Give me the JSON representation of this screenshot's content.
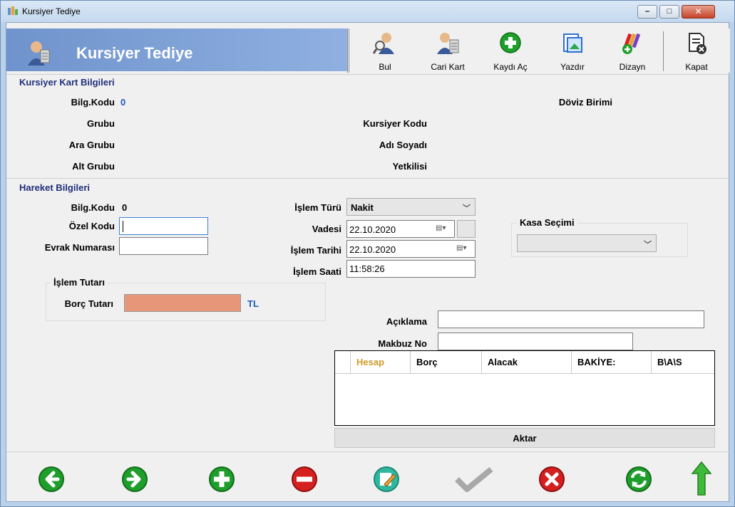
{
  "window": {
    "title": "Kursiyer Tediye",
    "controls": {
      "minimize": "–",
      "maximize": "□",
      "close": "✕"
    }
  },
  "header": {
    "title": "Kursiyer Tediye"
  },
  "toolbar": {
    "buttons": [
      {
        "key": "bul",
        "label": "Bul",
        "icon": "search-user-icon"
      },
      {
        "key": "cari_kart",
        "label": "Cari Kart",
        "icon": "user-card-icon"
      },
      {
        "key": "kaydi_ac",
        "label": "Kaydı Aç",
        "icon": "add-record-icon"
      },
      {
        "key": "yazdir",
        "label": "Yazdır",
        "icon": "print-icon"
      },
      {
        "key": "dizayn",
        "label": "Dizayn",
        "icon": "design-icon"
      },
      {
        "key": "kapat",
        "label": "Kapat",
        "icon": "close-document-icon"
      }
    ]
  },
  "kart": {
    "group_title": "Kursiyer Kart Bilgileri",
    "bilg_kodu_label": "Bilg.Kodu",
    "bilg_kodu_value": "0",
    "doviz_birimi_label": "Döviz Birimi",
    "grubu_label": "Grubu",
    "kursiyer_kodu_label": "Kursiyer Kodu",
    "ara_grubu_label": "Ara Grubu",
    "adi_soyadi_label": "Adı Soyadı",
    "alt_grubu_label": "Alt Grubu",
    "yetkilisi_label": "Yetkilisi"
  },
  "hareket": {
    "group_title": "Hareket Bilgileri",
    "bilg_kodu_label": "Bilg.Kodu",
    "bilg_kodu_value": "0",
    "ozel_kodu_label": "Özel Kodu",
    "ozel_kodu_value": "",
    "evrak_no_label": "Evrak Numarası",
    "evrak_no_value": "",
    "islem_turu_label": "İşlem Türü",
    "islem_turu_value": "Nakit",
    "vadesi_label": "Vadesi",
    "vadesi_value": "22.10.2020",
    "islem_tarihi_label": "İşlem Tarihi",
    "islem_tarihi_value": "22.10.2020",
    "islem_saati_label": "İşlem Saati",
    "islem_saati_value": "11:58:26",
    "kasa_secimi_label": "Kasa Seçimi",
    "kasa_secimi_value": "",
    "islem_tutari_title": "İşlem Tutarı",
    "borc_tutari_label": "Borç Tutarı",
    "borc_tutari_value": "",
    "currency": "TL",
    "aciklama_label": "Açıklama",
    "aciklama_value": "",
    "makbuz_no_label": "Makbuz No",
    "makbuz_no_value": ""
  },
  "grid": {
    "columns": [
      "Hesap",
      "Borç",
      "Alacak",
      "BAKİYE:",
      "B\\A\\S"
    ],
    "rows": []
  },
  "aktar_label": "Aktar",
  "bottom_nav": [
    {
      "key": "prev",
      "icon": "arrow-left-icon",
      "color": "#1e9e2a"
    },
    {
      "key": "next",
      "icon": "arrow-right-icon",
      "color": "#1e9e2a"
    },
    {
      "key": "add",
      "icon": "plus-icon",
      "color": "#1e9e2a"
    },
    {
      "key": "delete",
      "icon": "minus-icon",
      "color": "#d62020"
    },
    {
      "key": "edit",
      "icon": "edit-icon",
      "color": "#2fb8a0"
    },
    {
      "key": "confirm",
      "icon": "checkmark-icon",
      "color": "#a8a8a8"
    },
    {
      "key": "cancel",
      "icon": "cancel-icon",
      "color": "#d62020"
    },
    {
      "key": "refresh",
      "icon": "refresh-icon",
      "color": "#1e9e2a"
    },
    {
      "key": "up",
      "icon": "arrow-up-icon",
      "color": "#3fb93a"
    }
  ],
  "colors": {
    "borc_field": "#e8967a",
    "accent_blue": "#1c5bbd",
    "group_title": "#1f2e7a",
    "selected_column": "#d29a2a"
  }
}
